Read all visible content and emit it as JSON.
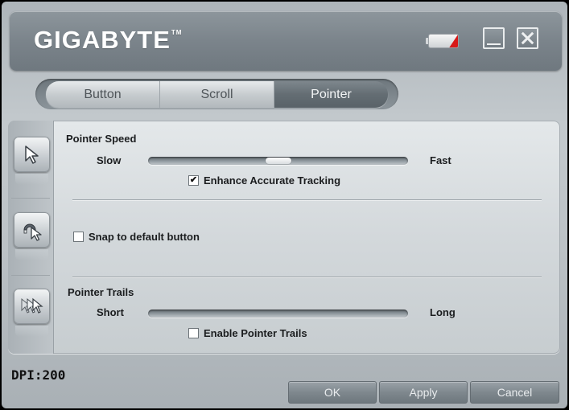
{
  "header": {
    "logo_text": "GIGABYTE",
    "logo_tm": "TM",
    "minimize_label": "",
    "close_label": ""
  },
  "tabs": [
    {
      "label": "Button",
      "active": false
    },
    {
      "label": "Scroll",
      "active": false
    },
    {
      "label": "Pointer",
      "active": true
    }
  ],
  "pointer_speed": {
    "title": "Pointer Speed",
    "min_label": "Slow",
    "max_label": "Fast",
    "value": 0.5,
    "enhance_label": "Enhance Accurate Tracking",
    "enhance_checked": true
  },
  "snap": {
    "label": "Snap to default button",
    "checked": false
  },
  "pointer_trails": {
    "title": "Pointer Trails",
    "min_label": "Short",
    "max_label": "Long",
    "enable_label": "Enable Pointer Trails",
    "enable_checked": false
  },
  "status": {
    "dpi": "DPI:200"
  },
  "footer": {
    "ok_label": "OK",
    "apply_label": "Apply",
    "cancel_label": "Cancel"
  },
  "colors": {
    "battery_indicator": "#d81818",
    "active_tab": "#646d73"
  },
  "icons": {
    "battery": "battery-icon",
    "minimize": "minimize-icon",
    "close": "close-icon",
    "pointer_speed": "cursor-arrow-icon",
    "snap": "magnet-cursor-icon",
    "trails": "cursor-trails-icon"
  }
}
